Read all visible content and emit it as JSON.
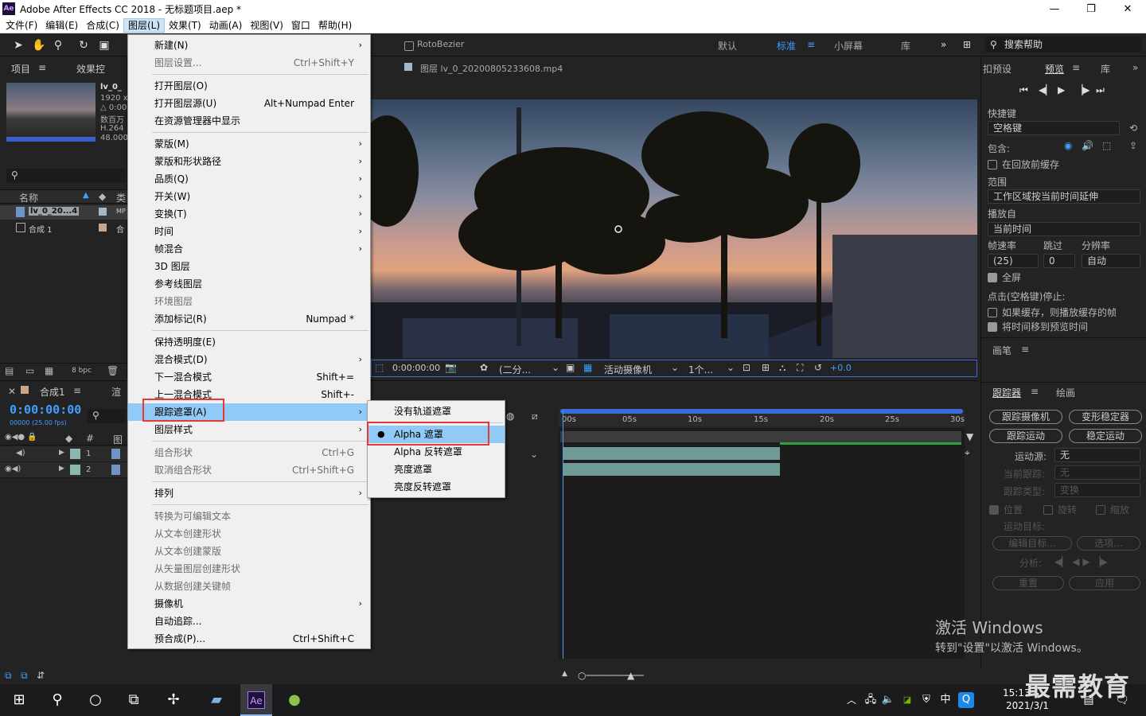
{
  "window": {
    "title": "Adobe After Effects CC 2018 - 无标题项目.aep *",
    "app_icon": "Ae",
    "minimize": "—",
    "maximize": "❐",
    "close": "✕"
  },
  "menubar": [
    "文件(F)",
    "编辑(E)",
    "合成(C)",
    "图层(L)",
    "效果(T)",
    "动画(A)",
    "视图(V)",
    "窗口",
    "帮助(H)"
  ],
  "toolbar": {
    "rotobezier": "RotoBezier",
    "workspaces": [
      "默认",
      "标准",
      "小屏幕",
      "库"
    ],
    "search_placeholder": "搜索帮助"
  },
  "project_panel": {
    "tab_project": "项目",
    "tab_effects": "效果控",
    "item_name": "lv_0_",
    "info_1": "1920 x 1",
    "info_2": "△ 0:00:",
    "info_3": "数百万",
    "info_4": "H.264",
    "info_5": "48.000",
    "col_name": "名称",
    "col_type": "类",
    "rows": [
      {
        "name": "lv_0_20...4",
        "type": "MP"
      },
      {
        "name": "合成 1",
        "type": "合"
      }
    ],
    "bpc": "8 bpc"
  },
  "timeline": {
    "comp_tab": "合成1",
    "render_tab": "渲",
    "timecode": "0:00:00:00",
    "timecode_sub": "00000 (25.00 fps)",
    "col_num": "#",
    "col_src": "图",
    "layers": [
      {
        "num": "1"
      },
      {
        "num": "2"
      }
    ],
    "ruler_labels": [
      "00s",
      "05s",
      "10s",
      "15s",
      "20s",
      "25s",
      "30s"
    ]
  },
  "viewer": {
    "tab_label": "图层 lv_0_20200805233608.mp4",
    "timecode": "0:00:00:00",
    "resolution": "(二分...",
    "camera": "活动摄像机",
    "views": "1个...",
    "exposure": "+0.0"
  },
  "preview_panel": {
    "tab_presets": "扣预设",
    "tab_preview": "预览",
    "tab_lib": "库",
    "shortcut_label": "快捷键",
    "shortcut_value": "空格键",
    "include_label": "包含:",
    "cache_before": "在回放前缓存",
    "range_label": "范围",
    "range_value": "工作区域按当前时间延伸",
    "play_from_label": "播放自",
    "play_from_value": "当前时间",
    "fps_label": "帧速率",
    "skip_label": "跳过",
    "res_label": "分辨率",
    "fps_value": "(25)",
    "skip_value": "0",
    "res_value": "自动",
    "fullscreen": "全屏",
    "on_stop_label": "点击(空格键)停止:",
    "if_cached": "如果缓存，则播放缓存的帧",
    "move_time": "将时间移到预览时间",
    "brush_tab": "画笔"
  },
  "tracker_panel": {
    "tab_tracker": "跟踪器",
    "tab_paint": "绘画",
    "btn_track_camera": "跟踪摄像机",
    "btn_warp": "变形稳定器",
    "btn_track_motion": "跟踪运动",
    "btn_stabilize": "稳定运动",
    "source_label": "运动源:",
    "source_value": "无",
    "current_label": "当前跟踪:",
    "current_value": "无",
    "type_label": "跟踪类型:",
    "type_value": "变换",
    "pos": "位置",
    "rot": "旋转",
    "scale": "缩放",
    "target_label": "运动目标:",
    "edit_target": "编辑目标...",
    "options": "选项...",
    "analyze": "分析:",
    "reset": "重置",
    "apply": "应用"
  },
  "layer_menu": [
    {
      "label": "新建(N)",
      "shortcut": "",
      "submenu": true,
      "disabled": false
    },
    {
      "label": "图层设置...",
      "shortcut": "Ctrl+Shift+Y",
      "submenu": false,
      "disabled": true
    },
    {
      "label": "打开图层(O)",
      "shortcut": "",
      "submenu": false,
      "disabled": false
    },
    {
      "label": "打开图层源(U)",
      "shortcut": "Alt+Numpad Enter",
      "submenu": false,
      "disabled": false
    },
    {
      "label": "在资源管理器中显示",
      "shortcut": "",
      "submenu": false,
      "disabled": false
    },
    {
      "label": "蒙版(M)",
      "shortcut": "",
      "submenu": true,
      "disabled": false
    },
    {
      "label": "蒙版和形状路径",
      "shortcut": "",
      "submenu": true,
      "disabled": false
    },
    {
      "label": "品质(Q)",
      "shortcut": "",
      "submenu": true,
      "disabled": false
    },
    {
      "label": "开关(W)",
      "shortcut": "",
      "submenu": true,
      "disabled": false
    },
    {
      "label": "变换(T)",
      "shortcut": "",
      "submenu": true,
      "disabled": false
    },
    {
      "label": "时间",
      "shortcut": "",
      "submenu": true,
      "disabled": false
    },
    {
      "label": "帧混合",
      "shortcut": "",
      "submenu": true,
      "disabled": false
    },
    {
      "label": "3D 图层",
      "shortcut": "",
      "submenu": false,
      "disabled": false
    },
    {
      "label": "参考线图层",
      "shortcut": "",
      "submenu": false,
      "disabled": false
    },
    {
      "label": "环境图层",
      "shortcut": "",
      "submenu": false,
      "disabled": true
    },
    {
      "label": "添加标记(R)",
      "shortcut": "Numpad *",
      "submenu": false,
      "disabled": false
    },
    {
      "label": "保持透明度(E)",
      "shortcut": "",
      "submenu": false,
      "disabled": false
    },
    {
      "label": "混合模式(D)",
      "shortcut": "",
      "submenu": true,
      "disabled": false
    },
    {
      "label": "下一混合模式",
      "shortcut": "Shift+=",
      "submenu": false,
      "disabled": false
    },
    {
      "label": "上一混合模式",
      "shortcut": "Shift+-",
      "submenu": false,
      "disabled": false
    },
    {
      "label": "跟踪遮罩(A)",
      "shortcut": "",
      "submenu": true,
      "disabled": false
    },
    {
      "label": "图层样式",
      "shortcut": "",
      "submenu": true,
      "disabled": false
    },
    {
      "label": "组合形状",
      "shortcut": "Ctrl+G",
      "submenu": false,
      "disabled": true
    },
    {
      "label": "取消组合形状",
      "shortcut": "Ctrl+Shift+G",
      "submenu": false,
      "disabled": true
    },
    {
      "label": "排列",
      "shortcut": "",
      "submenu": true,
      "disabled": false
    },
    {
      "label": "转换为可编辑文本",
      "shortcut": "",
      "submenu": false,
      "disabled": true
    },
    {
      "label": "从文本创建形状",
      "shortcut": "",
      "submenu": false,
      "disabled": true
    },
    {
      "label": "从文本创建蒙版",
      "shortcut": "",
      "submenu": false,
      "disabled": true
    },
    {
      "label": "从矢量图层创建形状",
      "shortcut": "",
      "submenu": false,
      "disabled": true
    },
    {
      "label": "从数据创建关键帧",
      "shortcut": "",
      "submenu": false,
      "disabled": true
    },
    {
      "label": "摄像机",
      "shortcut": "",
      "submenu": true,
      "disabled": false
    },
    {
      "label": "自动追踪...",
      "shortcut": "",
      "submenu": false,
      "disabled": false
    },
    {
      "label": "预合成(P)...",
      "shortcut": "Ctrl+Shift+C",
      "submenu": false,
      "disabled": false
    }
  ],
  "track_matte_submenu": [
    {
      "label": "没有轨道遮罩",
      "checked": false
    },
    {
      "label": "Alpha 遮罩",
      "checked": true
    },
    {
      "label": "Alpha 反转遮罩",
      "checked": false
    },
    {
      "label": "亮度遮罩",
      "checked": false
    },
    {
      "label": "亮度反转遮罩",
      "checked": false
    }
  ],
  "watermark": {
    "line1": "激活 Windows",
    "line2": "转到\"设置\"以激活 Windows。"
  },
  "taskbar": {
    "time": "15:13",
    "date": "2021/3/1",
    "ime": "中",
    "app_ae": "Ae"
  },
  "brand": "最需教育",
  "colors": {
    "accent_blue": "#3fa0ff",
    "menu_highlight": "#91c9f7",
    "annotation_red": "#e53935",
    "layer_teal": "#8ab8b0"
  }
}
